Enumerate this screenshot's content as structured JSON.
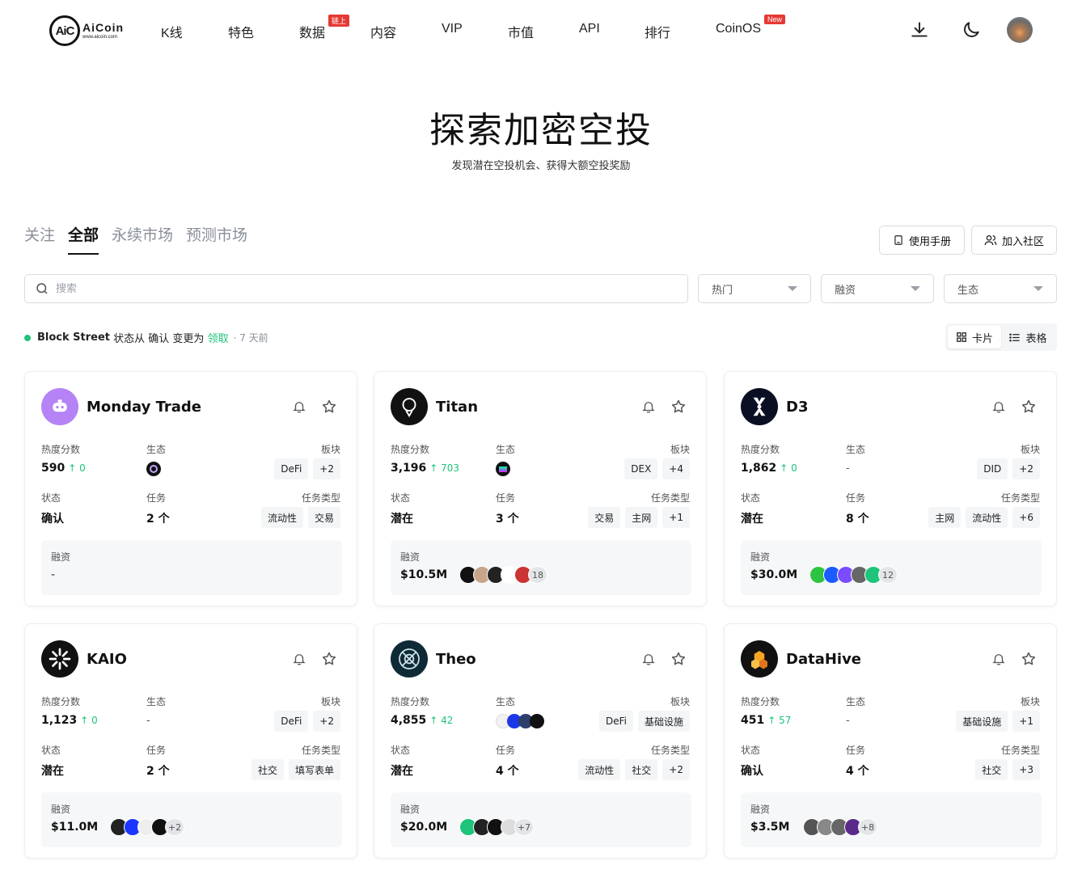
{
  "nav": {
    "logo_mark": "AiC",
    "logo_brand": "AiCoin",
    "logo_domain": "www.aicoin.com",
    "items": [
      {
        "label": "K线"
      },
      {
        "label": "特色"
      },
      {
        "label": "数据",
        "badge": "链上"
      },
      {
        "label": "内容"
      },
      {
        "label": "VIP"
      },
      {
        "label": "市值"
      },
      {
        "label": "API"
      },
      {
        "label": "排行"
      },
      {
        "label": "CoinOS",
        "badge": "New"
      }
    ],
    "icons": [
      "download-icon",
      "moon-icon",
      "avatar"
    ]
  },
  "hero": {
    "title": "探索加密空投",
    "subtitle": "发现潜在空投机会、获得大额空投奖励"
  },
  "tabs": [
    {
      "label": "关注",
      "active": false
    },
    {
      "label": "全部",
      "active": true
    },
    {
      "label": "永续市场",
      "active": false
    },
    {
      "label": "预测市场",
      "active": false
    }
  ],
  "actions": {
    "manual": "使用手册",
    "community": "加入社区"
  },
  "search": {
    "placeholder": "搜索"
  },
  "filters": [
    "热门",
    "融资",
    "生态"
  ],
  "notice": {
    "name": "Block Street",
    "text1": " 状态从 ",
    "from": "确认",
    "text2": " 变更为 ",
    "to": "领取",
    "time": "· 7 天前"
  },
  "view": {
    "card": "卡片",
    "table": "表格"
  },
  "labels": {
    "heat": "热度分数",
    "eco": "生态",
    "sector": "板块",
    "status": "状态",
    "tasks": "任务",
    "task_type": "任务类型",
    "funding": "融资"
  },
  "cards": [
    {
      "name": "Monday Trade",
      "heat": "590",
      "heat_up": "↑ 0",
      "eco": "",
      "sectors": [
        "DeFi",
        "+2"
      ],
      "status": "确认",
      "tasks": "2 个",
      "task_types": [
        "流动性",
        "交易"
      ],
      "funding": "-",
      "investors_more": ""
    },
    {
      "name": "Titan",
      "heat": "3,196",
      "heat_up": "↑ 703",
      "eco": "",
      "sectors": [
        "DEX",
        "+4"
      ],
      "status": "潜在",
      "tasks": "3 个",
      "task_types": [
        "交易",
        "主网",
        "+1"
      ],
      "funding": "$10.5M",
      "investors_more": "18"
    },
    {
      "name": "D3",
      "heat": "1,862",
      "heat_up": "↑ 0",
      "eco": "-",
      "sectors": [
        "DID",
        "+2"
      ],
      "status": "潜在",
      "tasks": "8 个",
      "task_types": [
        "主网",
        "流动性",
        "+6"
      ],
      "funding": "$30.0M",
      "investors_more": "12"
    },
    {
      "name": "KAIO",
      "heat": "1,123",
      "heat_up": "↑ 0",
      "eco": "-",
      "sectors": [
        "DeFi",
        "+2"
      ],
      "status": "潜在",
      "tasks": "2 个",
      "task_types": [
        "社交",
        "填写表单"
      ],
      "funding": "$11.0M",
      "investors_more": "+2"
    },
    {
      "name": "Theo",
      "heat": "4,855",
      "heat_up": "↑ 42",
      "eco": "",
      "sectors": [
        "DeFi",
        "基础设施"
      ],
      "status": "潜在",
      "tasks": "4 个",
      "task_types": [
        "流动性",
        "社交",
        "+2"
      ],
      "funding": "$20.0M",
      "investors_more": "+7"
    },
    {
      "name": "DataHive",
      "heat": "451",
      "heat_up": "↑ 57",
      "eco": "-",
      "sectors": [
        "基础设施",
        "+1"
      ],
      "status": "确认",
      "tasks": "4 个",
      "task_types": [
        "社交",
        "+3"
      ],
      "funding": "$3.5M",
      "investors_more": "+8"
    }
  ]
}
